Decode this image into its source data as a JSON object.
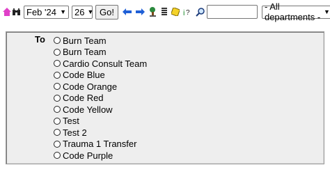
{
  "toolbar": {
    "month_select": "Feb '24",
    "day_select": "26",
    "go_label": "Go!",
    "search_value": "",
    "department_select": "- All departments -"
  },
  "form": {
    "to_label": "To",
    "recipients": [
      "Burn Team",
      "Burn Team",
      "Cardio Consult Team",
      "Code Blue",
      "Code Orange",
      "Code Red",
      "Code Yellow",
      "Test",
      "Test 2",
      "Trauma 1 Transfer",
      "Code Purple"
    ]
  }
}
